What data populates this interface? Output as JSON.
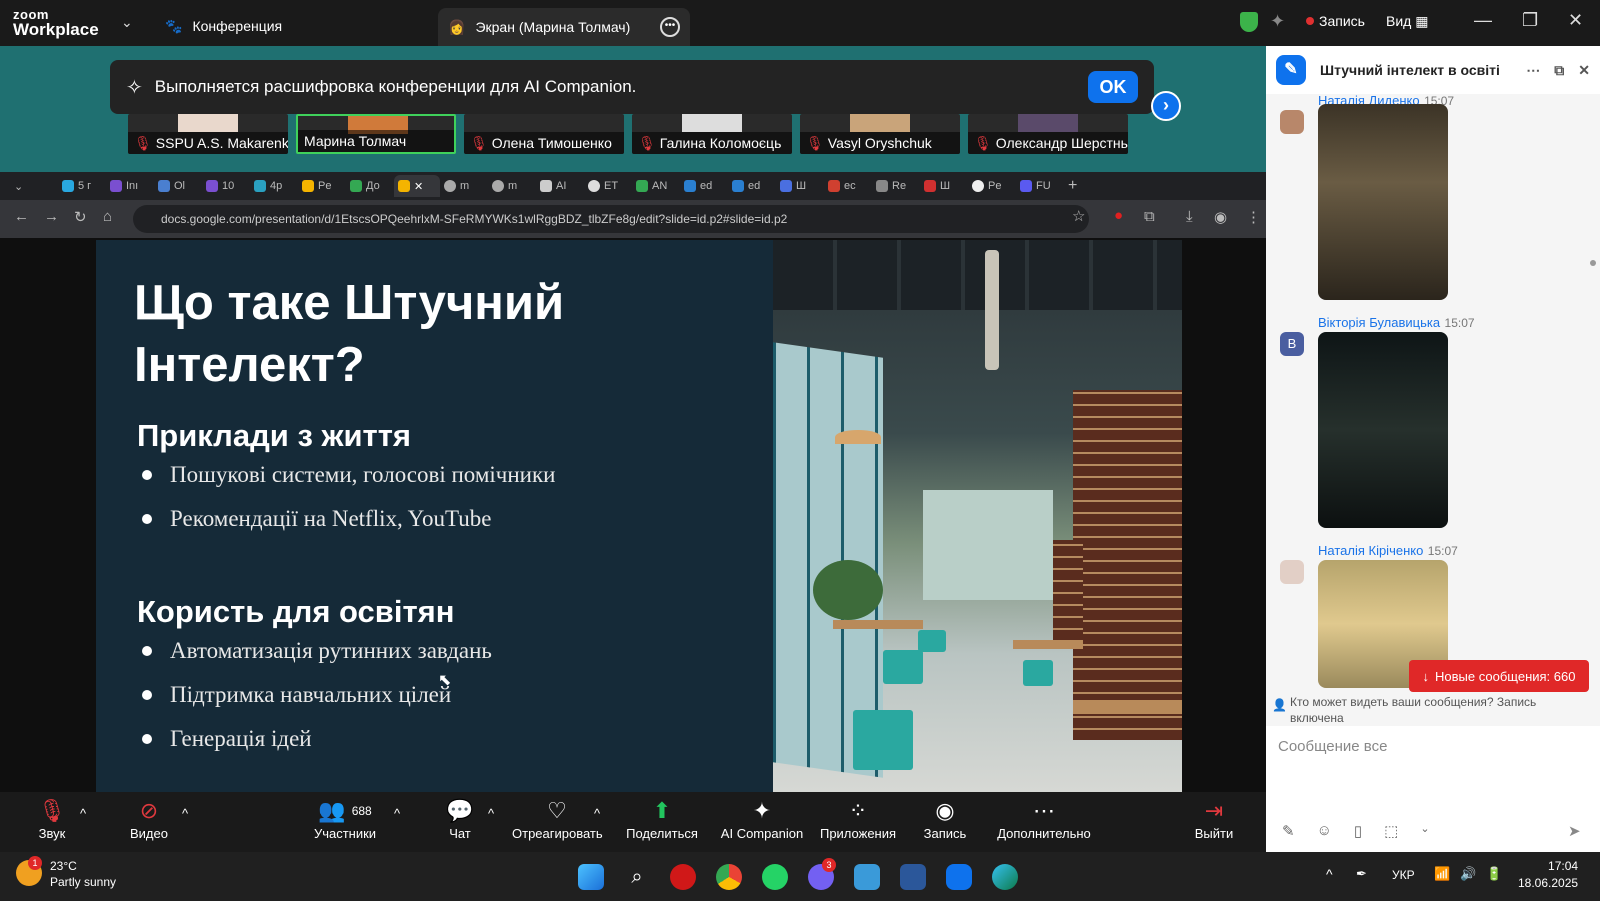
{
  "zoom": {
    "logo_line1": "zoom",
    "logo_line2": "Workplace",
    "tab_conference": "Конференция",
    "tab_screen": "Экран (Марина Толмач)",
    "record_label": "Запись",
    "view_label": "Вид",
    "notice_text": "Выполняется расшифровка конференции для AI Companion.",
    "notice_ok": "OK",
    "thumbnails": [
      {
        "name": "SSPU A.S. Makarenko ...",
        "muted": true
      },
      {
        "name": "Марина Толмач",
        "muted": false,
        "active": true
      },
      {
        "name": "Олена Тимошенко",
        "muted": true
      },
      {
        "name": "Галина Коломоєць",
        "muted": true
      },
      {
        "name": "Vasyl Oryshchuk",
        "muted": true
      },
      {
        "name": "Олександр Шерстньов",
        "muted": true
      }
    ]
  },
  "browser": {
    "url": "docs.google.com/presentation/d/1EtscsOPQeehrlxM-SFeRMYWKs1wlRggBDZ_tlbZFe8g/edit?slide=id.p2#slide=id.p2",
    "tabs": [
      "5 г",
      "Inı",
      "Ol",
      "10",
      "4p",
      "Pe",
      "До",
      "",
      "m",
      "m",
      "AI",
      "ET",
      "AN",
      "ed",
      "ed",
      "Ш",
      "ec",
      "Re",
      "Ш",
      "Pe",
      "FU"
    ]
  },
  "slide": {
    "title": "Що таке Штучний Інтелект?",
    "section1": "Приклади з життя",
    "bullets1": [
      "Пошукові системи, голосові помічники",
      "Рекомендації на Netflix, YouTube"
    ],
    "section2": "Користь для освітян",
    "bullets2": [
      "Автоматизація рутинних завдань",
      "Підтримка навчальних цілей",
      "Генерація ідей"
    ]
  },
  "chat": {
    "title": "Штучний інтелект в освіті",
    "messages": [
      {
        "name": "Наталія Диденко",
        "time": "15:07",
        "avatar": "photo"
      },
      {
        "name": "Вікторія Булавицька",
        "time": "15:07",
        "avatar": "B"
      },
      {
        "name": "Наталія Кіріченко",
        "time": "15:07",
        "avatar": "photo"
      }
    ],
    "new_messages": "Новые сообщения: 660",
    "who_can_see": "Кто может видеть ваши сообщения? Запись включена",
    "input_placeholder": "Сообщение все"
  },
  "toolbar": {
    "audio": "Звук",
    "video": "Видео",
    "participants": "Участники",
    "participants_count": "688",
    "chat": "Чат",
    "react": "Отреагировать",
    "share": "Поделиться",
    "ai": "AI Companion",
    "apps": "Приложения",
    "record": "Запись",
    "more": "Дополнительно",
    "leave": "Выйти"
  },
  "taskbar": {
    "weather_temp": "23°C",
    "weather_desc": "Partly sunny",
    "weather_badge": "1",
    "viber_badge": "3",
    "lang": "УКР",
    "time": "17:04",
    "date": "18.06.2025"
  },
  "colors": {
    "zoom_blue": "#0e72ed",
    "stage_teal": "#1f7071",
    "slide_bg": "#152a38",
    "leave_red": "#e02828"
  }
}
